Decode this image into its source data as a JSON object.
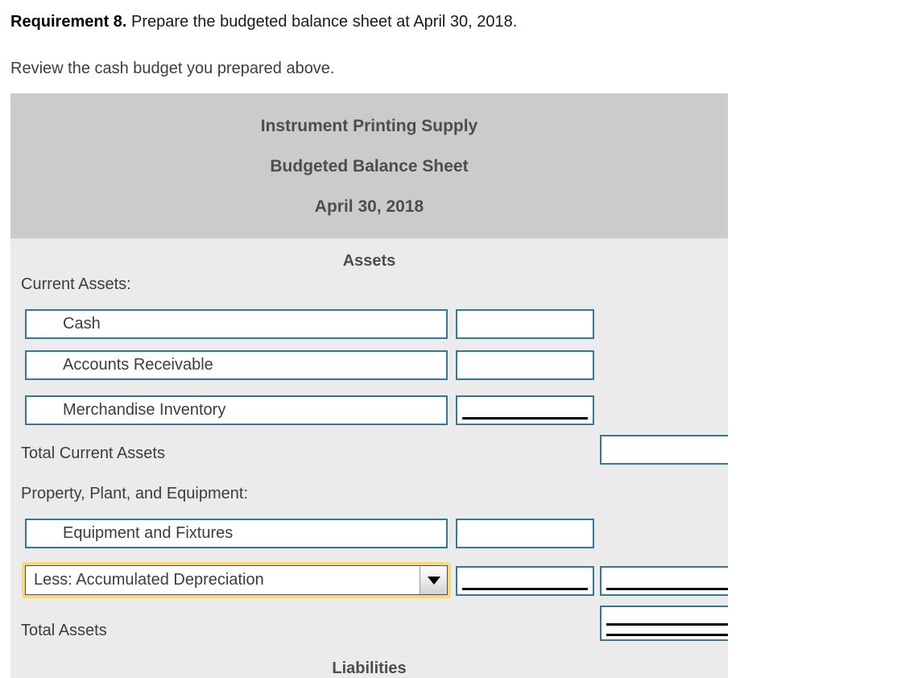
{
  "intro": {
    "requirement_label": "Requirement 8.",
    "requirement_text": " Prepare the budgeted balance sheet at April 30, 2018.",
    "review_text": "Review the cash budget you prepared above."
  },
  "worksheet": {
    "header": {
      "company": "Instrument Printing Supply",
      "statement": "Budgeted Balance Sheet",
      "date": "April 30, 2018"
    },
    "sections": {
      "assets_title": "Assets",
      "liabilities_title": "Liabilities"
    },
    "rows": [
      {
        "type": "plain",
        "label": "Current Assets:"
      },
      {
        "type": "boxed",
        "label": "Cash",
        "amount1": "",
        "amount2": ""
      },
      {
        "type": "boxed",
        "label": "Accounts Receivable",
        "amount1": "",
        "amount2": ""
      },
      {
        "type": "boxed",
        "label": "Merchandise Inventory",
        "amount1": "",
        "amount2": ""
      },
      {
        "type": "total",
        "label": "Total Current Assets",
        "amount2": ""
      },
      {
        "type": "plain",
        "label": "Property, Plant, and Equipment:"
      },
      {
        "type": "boxed",
        "label": "Equipment and Fixtures",
        "amount1": "",
        "amount2": ""
      },
      {
        "type": "select",
        "label": "Less: Accumulated Depreciation",
        "amount1": "",
        "amount2": ""
      },
      {
        "type": "total",
        "label": "Total Assets",
        "amount2": ""
      }
    ],
    "select_value": "Less: Accumulated Depreciation",
    "dropdown_icon": "chevron-down-icon"
  },
  "colors": {
    "panel_header_bg": "#cbcbcb",
    "panel_bg": "#ebebeb",
    "box_border": "#33779b",
    "focus_ring": "#f7d978",
    "heading_text": "#4d4d4d",
    "body_text": "#3d3d3d"
  }
}
